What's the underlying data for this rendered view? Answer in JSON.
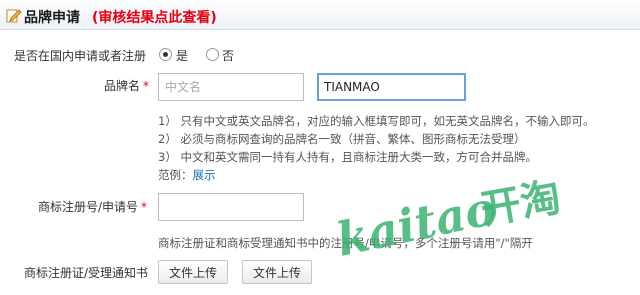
{
  "header": {
    "title": "品牌申请",
    "note": "(审核结果点此查看)"
  },
  "domestic": {
    "label": "是否在国内申请或者注册",
    "options": [
      {
        "label": "是",
        "checked": true
      },
      {
        "label": "否",
        "checked": false
      }
    ]
  },
  "brand_name": {
    "label": "品牌名",
    "required_mark": "*",
    "cn_placeholder": "中文名",
    "en_value": "TIANMAO",
    "hints": [
      "1） 只有中文或英文品牌名，对应的输入框填写即可，如无英文品牌名，不输入即可。",
      "2） 必须与商标网查询的品牌名一致（拼音、繁体、图形商标无法受理）",
      "3） 中文和英文需同一持有人持有，且商标注册大类一致，方可合并品牌。"
    ],
    "example_label": "范例：",
    "example_link": "展示"
  },
  "reg_no": {
    "label": "商标注册号/申请号",
    "required_mark": "*",
    "value": "",
    "hint": "商标注册证和商标受理通知书中的注册号/申请号，多个注册号请用\"/\"隔开"
  },
  "certificate": {
    "label": "商标注册证/受理通知书",
    "upload1": "文件上传",
    "upload2": "文件上传"
  },
  "watermark": {
    "latin": "kaitao",
    "cn": "开淘"
  },
  "colors": {
    "required": "#e60012",
    "link": "#1f6fb2",
    "watermark": "#3cb371"
  }
}
